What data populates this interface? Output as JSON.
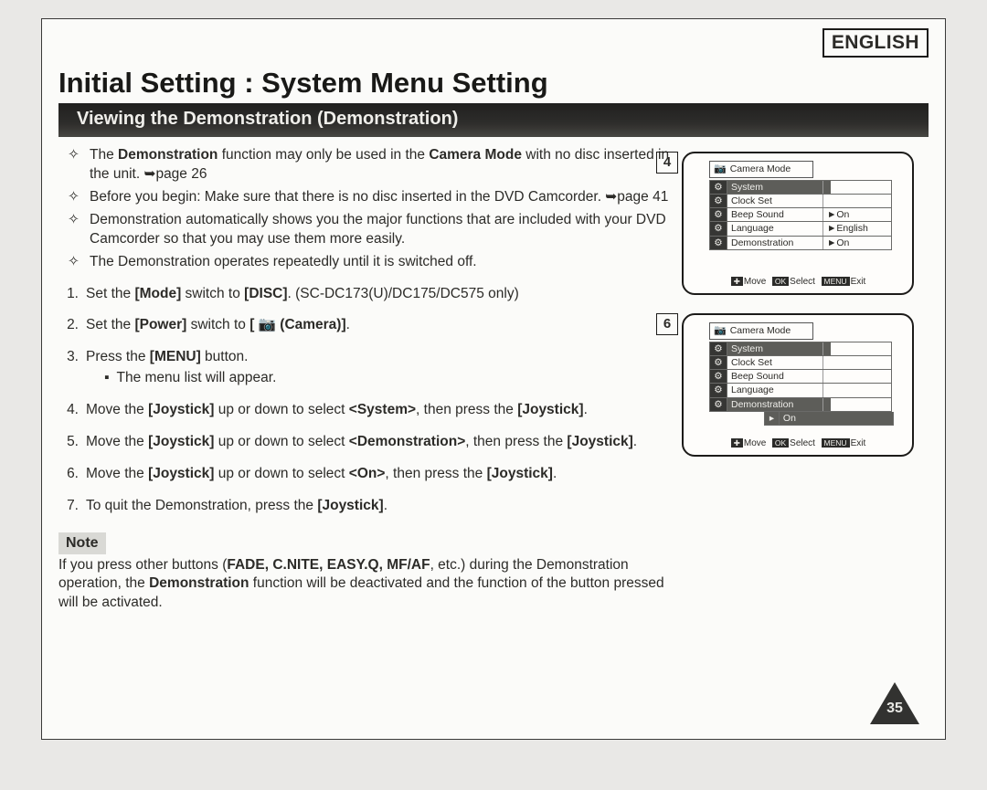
{
  "language_label": "ENGLISH",
  "headline_prefix": "Initial Setting : ",
  "headline_main": "System Menu Setting",
  "section_bar": "Viewing the Demonstration (Demonstration)",
  "bullet_glyph": "✧",
  "intro_bullets": [
    {
      "pre": "The ",
      "b1": "Demonstration",
      "mid1": " function may only be used in the ",
      "b2": "Camera Mode",
      "post": " with no disc inserted in the unit. ➥page 26"
    },
    {
      "pre": "Before you begin: Make sure that there is no disc inserted in the DVD Camcorder. ➥page 41",
      "b1": "",
      "mid1": "",
      "b2": "",
      "post": ""
    },
    {
      "pre": "Demonstration automatically shows you the major functions that are included with your DVD Camcorder so that you may use them more easily.",
      "b1": "",
      "mid1": "",
      "b2": "",
      "post": ""
    },
    {
      "pre": "The Demonstration operates repeatedly until it is switched off.",
      "b1": "",
      "mid1": "",
      "b2": "",
      "post": ""
    }
  ],
  "steps": [
    {
      "n": "1.",
      "pre": "Set the ",
      "b1": "[Mode]",
      "mid": " switch to ",
      "b2": "[DISC]",
      "post": ". (SC-DC173(U)/DC175/DC575 only)"
    },
    {
      "n": "2.",
      "pre": "Set the ",
      "b1": "[Power]",
      "mid": " switch to ",
      "b2": "[ 📷 (Camera)]",
      "post": "."
    },
    {
      "n": "3.",
      "pre": "Press the ",
      "b1": "[MENU]",
      "mid": " button.",
      "b2": "",
      "post": "",
      "sub": "The menu list will appear."
    },
    {
      "n": "4.",
      "pre": "Move the ",
      "b1": "[Joystick]",
      "mid": " up or down to select ",
      "b2": "<System>",
      "post": ", then press the ",
      "b3": "[Joystick]",
      "post2": "."
    },
    {
      "n": "5.",
      "pre": "Move the ",
      "b1": "[Joystick]",
      "mid": " up or down to select ",
      "b2": "<Demonstration>",
      "post": ", then press the ",
      "b3": "[Joystick]",
      "post2": "."
    },
    {
      "n": "6.",
      "pre": "Move the ",
      "b1": "[Joystick]",
      "mid": " up or down to select ",
      "b2": "<On>",
      "post": ", then press the ",
      "b3": "[Joystick]",
      "post2": "."
    },
    {
      "n": "7.",
      "pre": "To quit the Demonstration, press the ",
      "b1": "[Joystick]",
      "mid": ".",
      "b2": "",
      "post": ""
    }
  ],
  "note_label": "Note",
  "note": {
    "pre": "If you press other buttons (",
    "b1": "FADE, C.NITE, EASY.Q, MF/AF",
    "mid": ", etc.) during the Demonstration operation, the ",
    "b2": "Demonstration",
    "post": " function will be deactivated and the function of the button pressed will be activated."
  },
  "page_number": "35",
  "osd_common": {
    "title": "Camera Mode",
    "rows": [
      {
        "icon": "►",
        "label": "System",
        "value": "",
        "sys": true
      },
      {
        "icon": "",
        "label": "Clock Set",
        "value": ""
      },
      {
        "icon": "",
        "label": "Beep Sound",
        "value": "►On"
      },
      {
        "icon": "",
        "label": "Language",
        "value": "►English"
      },
      {
        "icon": "",
        "label": "Demonstration",
        "value": "►On"
      }
    ],
    "footer_move": "Move",
    "footer_select": "Select",
    "footer_exit": "Exit",
    "footer_icon_move": "✚",
    "footer_icon_ok": "OK",
    "footer_icon_menu": "MENU"
  },
  "fig4_num": "4",
  "fig6_num": "6",
  "fig6_rows": [
    {
      "icon": "►",
      "label": "System",
      "value": "",
      "sys": true
    },
    {
      "icon": "",
      "label": "Clock Set",
      "value": ""
    },
    {
      "icon": "",
      "label": "Beep Sound",
      "value": ""
    },
    {
      "icon": "",
      "label": "Language",
      "value": ""
    },
    {
      "icon": "",
      "label": "Demonstration",
      "value": "",
      "sel": true
    },
    {
      "icon": "",
      "label": "On",
      "value": "",
      "subsel": true
    }
  ]
}
